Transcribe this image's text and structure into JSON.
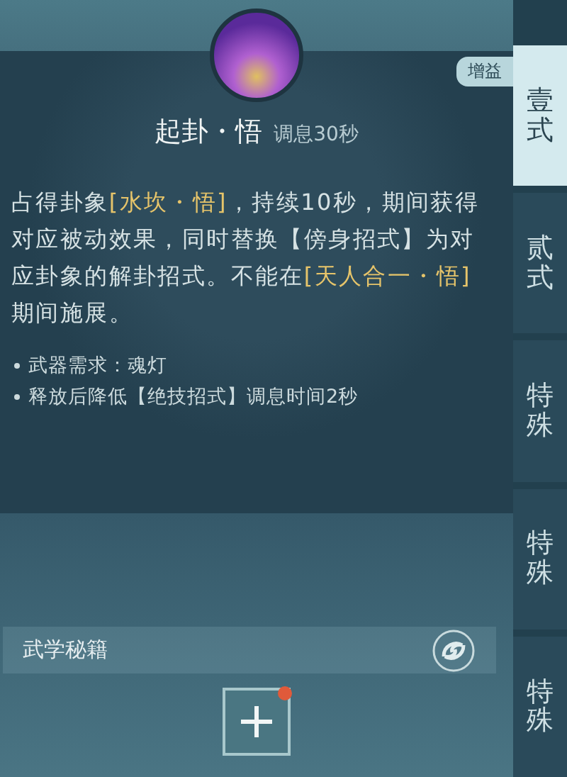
{
  "skill": {
    "name": "起卦・悟",
    "cooldown": "调息30秒",
    "description": [
      {
        "kind": "plain",
        "text": "占得卦象"
      },
      {
        "kind": "term",
        "text": "[水坎・悟]"
      },
      {
        "kind": "plain",
        "text": "，持续10秒，期间获得对应被动效果，同时替换【傍身招式】为对应卦象的解卦招式。不能在"
      },
      {
        "kind": "term",
        "text": "[天人合一・悟]"
      },
      {
        "kind": "plain",
        "text": "期间施展。"
      }
    ],
    "notes": [
      "武器需求：魂灯",
      "释放后降低【绝技招式】调息时间2秒"
    ]
  },
  "badge": "增益",
  "tabs": [
    {
      "label": "壹式",
      "selected": true
    },
    {
      "label": "贰式",
      "selected": false
    },
    {
      "label": "特殊",
      "selected": false
    },
    {
      "label": "特殊",
      "selected": false
    },
    {
      "label": "特殊",
      "selected": false
    }
  ],
  "manual": {
    "label": "武学秘籍",
    "add_alert": true
  }
}
